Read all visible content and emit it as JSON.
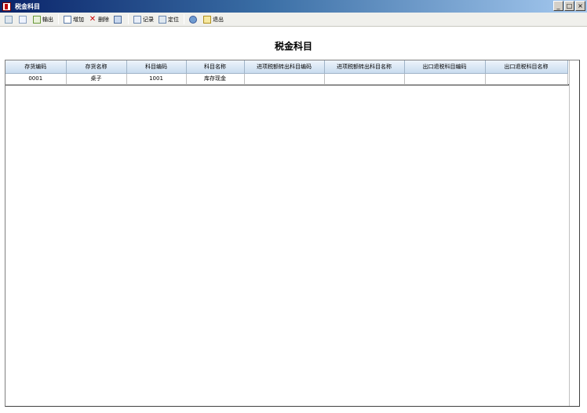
{
  "window": {
    "title": "税金科目",
    "buttons": [
      "_",
      "□",
      "×"
    ]
  },
  "toolbar": {
    "items": [
      {
        "icon": "print-icon",
        "label": ""
      },
      {
        "icon": "preview-icon",
        "label": ""
      },
      {
        "icon": "export-icon",
        "label": "输出"
      },
      {
        "icon": "add-icon",
        "label": "增加"
      },
      {
        "icon": "delete-icon",
        "label": "删除"
      },
      {
        "icon": "save-icon",
        "label": ""
      },
      {
        "icon": "record-icon",
        "label": "记录"
      },
      {
        "icon": "locate-icon",
        "label": "定位"
      },
      {
        "icon": "help-icon",
        "label": ""
      },
      {
        "icon": "exit-icon",
        "label": "退出"
      }
    ]
  },
  "page": {
    "title": "税金科目"
  },
  "grid": {
    "columns": [
      "存货编码",
      "存货名称",
      "科目编码",
      "科目名称",
      "进项税额转出科目编码",
      "进项税额转出科目名称",
      "出口退税科目编码",
      "出口退税科目名称"
    ],
    "rows": [
      [
        "0001",
        "桌子",
        "1001",
        "库存现金",
        "",
        "",
        "",
        ""
      ]
    ]
  }
}
